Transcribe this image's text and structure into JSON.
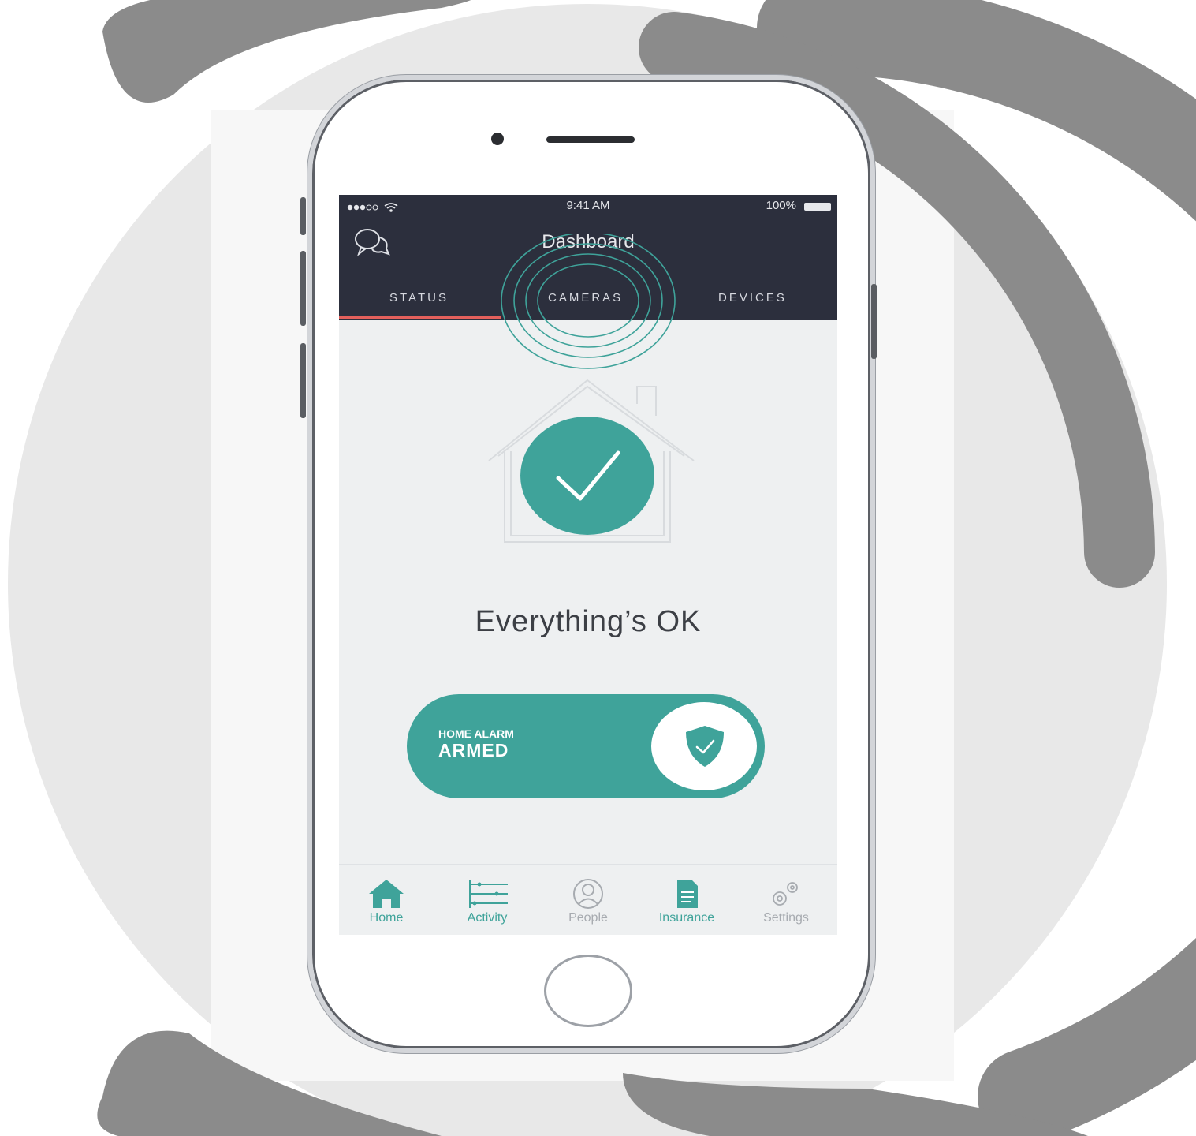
{
  "status_bar": {
    "time": "9:41 AM",
    "battery": "100%"
  },
  "header": {
    "title": "Dashboard",
    "tabs": [
      {
        "label": "STATUS",
        "active": true
      },
      {
        "label": "CAMERAS",
        "active": false
      },
      {
        "label": "DEVICES",
        "active": false
      }
    ]
  },
  "main": {
    "status_message": "Everything’s OK",
    "alarm": {
      "label": "HOME ALARM",
      "state": "ARMED"
    }
  },
  "tabbar": {
    "items": [
      {
        "label": "Home",
        "icon": "home-icon",
        "active": true
      },
      {
        "label": "Activity",
        "icon": "activity-icon",
        "active": false
      },
      {
        "label": "People",
        "icon": "people-icon",
        "active": false
      },
      {
        "label": "Insurance",
        "icon": "insurance-icon",
        "active": false
      },
      {
        "label": "Settings",
        "icon": "settings-icon",
        "active": false
      }
    ]
  },
  "colors": {
    "accent": "#3fa39a",
    "header": "#2c2f3d",
    "tab_underline": "#e4605c",
    "swirl": "#8b8b8b"
  }
}
